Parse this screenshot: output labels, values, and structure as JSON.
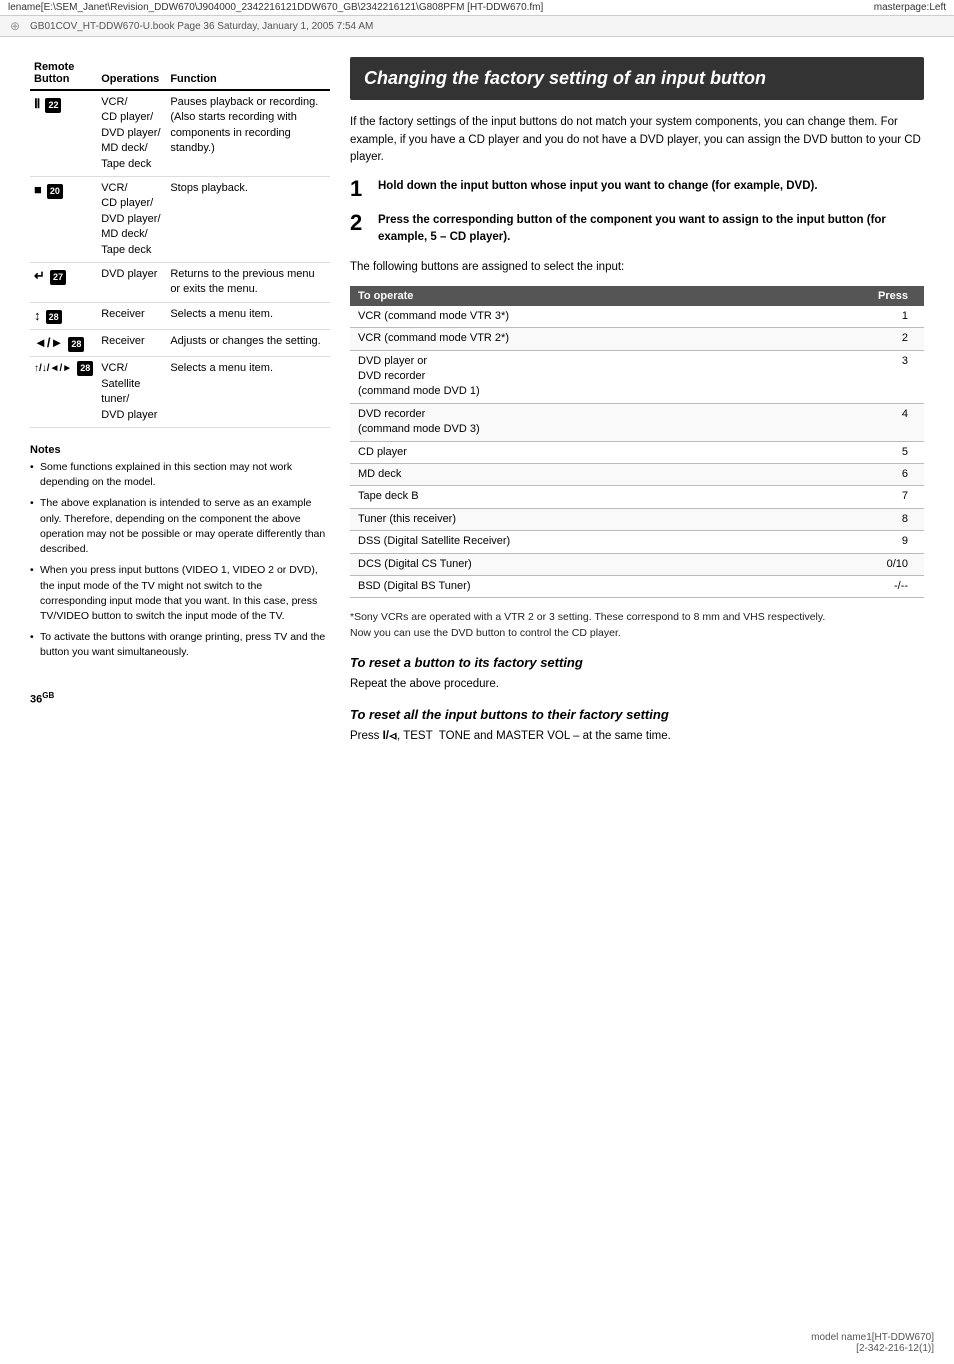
{
  "topBar": {
    "left": "lename[E:\\SEM_Janet\\Revision_DDW670\\J904000_2342216121DDW670_GB\\2342216121\\G808PFM [HT-DDW670.fm]",
    "right": "masterpage:Left"
  },
  "fileBar": {
    "text": "GB01COV_HT-DDW670-U.book  Page 36  Saturday, January 1, 2005  7:54 AM"
  },
  "table": {
    "headers": [
      "Remote Button",
      "Operations",
      "Function"
    ],
    "rows": [
      {
        "button": "II 22",
        "buttonSymbol": "II",
        "buttonNum": "22",
        "operations": "VCR/\nCD player/\nDVD player/\nMD deck/\nTape deck",
        "function": "Pauses playback or recording. (Also starts recording with components in recording standby.)"
      },
      {
        "button": "■ 20",
        "buttonSymbol": "■",
        "buttonNum": "20",
        "operations": "VCR/\nCD player/\nDVD player/\nMD deck/\nTape deck",
        "function": "Stops playback."
      },
      {
        "button": "↩ 27",
        "buttonSymbol": "↩",
        "buttonNum": "27",
        "operations": "DVD player",
        "function": "Returns to the previous menu or exits the menu."
      },
      {
        "button": "↑/↓ 28",
        "buttonSymbol": "↑/↓",
        "buttonNum": "28",
        "operations": "Receiver",
        "function": "Selects a menu item."
      },
      {
        "button": "◄/► 28",
        "buttonSymbol": "◄/►",
        "buttonNum": "28",
        "operations": "Receiver",
        "function": "Adjusts or changes the setting."
      },
      {
        "button": "↑/↓/◄/► 28",
        "buttonSymbol": "↑/↓/◄/►",
        "buttonNum": "28",
        "operations": "VCR/\nSatellite tuner/\nDVD player",
        "function": "Selects a menu item."
      }
    ]
  },
  "notes": {
    "title": "Notes",
    "items": [
      "Some functions explained in this section may not work depending on the model.",
      "The above explanation is intended to serve as an example only. Therefore, depending on the component the above operation may not be possible or may operate differently than described.",
      "When you press input buttons (VIDEO 1, VIDEO 2 or DVD), the input mode of the TV might not switch to the corresponding input mode that you want. In this case, press TV/VIDEO button to switch the input mode of the TV.",
      "To activate the buttons with orange printing, press TV and the button you want simultaneously."
    ]
  },
  "pageNum": "36",
  "pageNumSup": "GB",
  "rightSection": {
    "heading": "Changing the factory setting of an input button",
    "intro": "If the factory settings of the input buttons do not match your system components, you can change them. For example, if you have a CD player and you do not have a DVD player, you can assign the DVD button to your CD player.",
    "steps": [
      {
        "num": "1",
        "text": "Hold down the input button whose input you want to change (for example, DVD)."
      },
      {
        "num": "2",
        "text": "Press the corresponding button of the component you want to assign to the input button (for example, 5 – CD player)."
      }
    ],
    "step2Sub": "The following buttons are assigned to select the input:",
    "inputTable": {
      "headers": [
        "To operate",
        "Press"
      ],
      "rows": [
        {
          "operate": "VCR (command mode VTR 3*)",
          "press": "1"
        },
        {
          "operate": "VCR (command mode VTR 2*)",
          "press": "2"
        },
        {
          "operate": "DVD player  or\nDVD recorder\n(command mode DVD 1)",
          "press": "3"
        },
        {
          "operate": "DVD recorder\n(command mode DVD 3)",
          "press": "4"
        },
        {
          "operate": "CD player",
          "press": "5"
        },
        {
          "operate": "MD deck",
          "press": "6"
        },
        {
          "operate": "Tape deck B",
          "press": "7"
        },
        {
          "operate": "Tuner (this receiver)",
          "press": "8"
        },
        {
          "operate": "DSS (Digital Satellite Receiver)",
          "press": "9"
        },
        {
          "operate": "DCS (Digital CS Tuner)",
          "press": "0/10"
        },
        {
          "operate": "BSD (Digital BS Tuner)",
          "press": "-/--"
        }
      ]
    },
    "footnote": "*Sony VCRs are operated with a VTR 2 or 3 setting. These correspond to 8 mm and VHS respectively.\nNow you can use the DVD button to control the CD player.",
    "resetHeading1": "To reset a button to its factory setting",
    "resetText1": "Repeat the above procedure.",
    "resetHeading2": "To reset all the input buttons to their factory setting",
    "resetText2": "Press I/⏻, TEST  TONE and MASTER VOL – at the same time."
  },
  "bottomBar": {
    "model": "model name1[HT-DDW670]",
    "code": "[2-342-216-12(1)]"
  }
}
